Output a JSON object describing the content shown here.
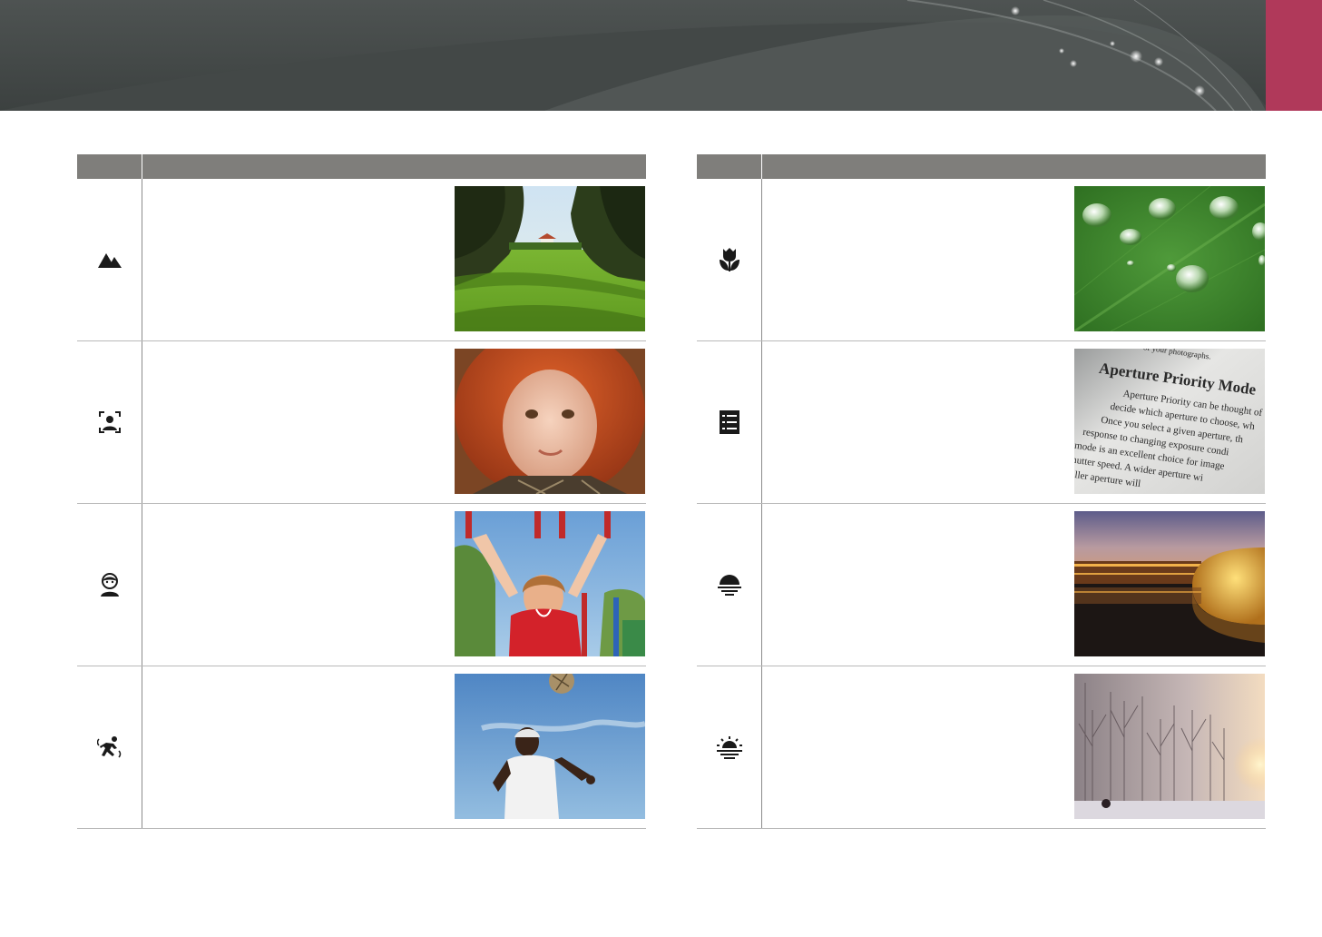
{
  "header": {
    "accent_color": "#b0395a",
    "banner_color": "#474c4b"
  },
  "left_table": {
    "headers": {
      "icon": "",
      "description": ""
    },
    "rows": [
      {
        "icon": "landscape-icon",
        "text": "",
        "photo": "park-lawn-photo"
      },
      {
        "icon": "portrait-icon",
        "text": "",
        "photo": "red-haired-girl-photo"
      },
      {
        "icon": "children-icon",
        "text": "",
        "photo": "girl-on-rings-photo"
      },
      {
        "icon": "sports-icon",
        "text": "",
        "photo": "soccer-player-photo"
      }
    ]
  },
  "right_table": {
    "headers": {
      "icon": "",
      "description": ""
    },
    "rows": [
      {
        "icon": "macro-icon",
        "text": "",
        "photo": "water-drops-photo"
      },
      {
        "icon": "text-icon",
        "text": "",
        "photo": "book-page-photo"
      },
      {
        "icon": "sunset-icon",
        "text": "",
        "photo": "night-buildings-photo"
      },
      {
        "icon": "dawn-icon",
        "text": "",
        "photo": "foggy-trees-photo"
      }
    ],
    "book_photo_lines": [
      "of your photographs.",
      "Aperture Priority Mode",
      "Aperture Priority can be thought of",
      "decide which aperture to choose, wh",
      "Once you select a given aperture, th",
      "response to changing exposure condi",
      "mode is an excellent choice for image",
      "shutter speed. A wider aperture wi",
      "smaller aperture will"
    ]
  }
}
